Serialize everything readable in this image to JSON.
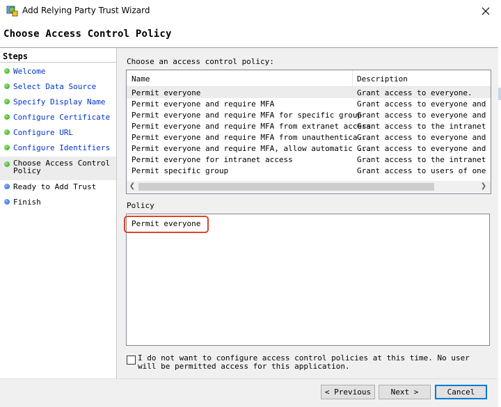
{
  "window": {
    "title": "Add Relying Party Trust Wizard"
  },
  "page": {
    "heading": "Choose Access Control Policy"
  },
  "steps": {
    "title": "Steps",
    "items": [
      {
        "label": "Welcome",
        "state": "done"
      },
      {
        "label": "Select Data Source",
        "state": "done"
      },
      {
        "label": "Specify Display Name",
        "state": "done"
      },
      {
        "label": "Configure Certificate",
        "state": "done"
      },
      {
        "label": "Configure URL",
        "state": "done"
      },
      {
        "label": "Configure Identifiers",
        "state": "done"
      },
      {
        "label": "Choose Access Control Policy",
        "state": "current"
      },
      {
        "label": "Ready to Add Trust",
        "state": "todo"
      },
      {
        "label": "Finish",
        "state": "todo"
      }
    ]
  },
  "policy_list": {
    "label": "Choose an access control policy:",
    "columns": {
      "name": "Name",
      "description": "Description"
    },
    "rows": [
      {
        "name": "Permit everyone",
        "description": "Grant access to everyone.",
        "selected": true
      },
      {
        "name": "Permit everyone and require MFA",
        "description": "Grant access to everyone and req"
      },
      {
        "name": "Permit everyone and require MFA for specific group",
        "description": "Grant access to everyone and req"
      },
      {
        "name": "Permit everyone and require MFA from extranet access",
        "description": "Grant access to the intranet use"
      },
      {
        "name": "Permit everyone and require MFA from unauthentica...",
        "description": "Grant access to everyone and req"
      },
      {
        "name": "Permit everyone and require MFA, allow automatic ...",
        "description": "Grant access to everyone and req"
      },
      {
        "name": "Permit everyone for intranet access",
        "description": "Grant access to the intranet use"
      },
      {
        "name": "Permit specific group",
        "description": "Grant access to users of one or"
      }
    ]
  },
  "policy": {
    "label": "Policy",
    "value": "Permit everyone"
  },
  "skip_checkbox": {
    "label": "I do not want to configure access control policies at this time. No user will be permitted access for this application.",
    "checked": false
  },
  "buttons": {
    "previous": "< Previous",
    "next": "Next >",
    "cancel": "Cancel"
  },
  "colors": {
    "highlight": "#d9442c",
    "link": "#0033cc",
    "done_dot": "#2e9e1b",
    "todo_dot": "#1f5fd6"
  }
}
